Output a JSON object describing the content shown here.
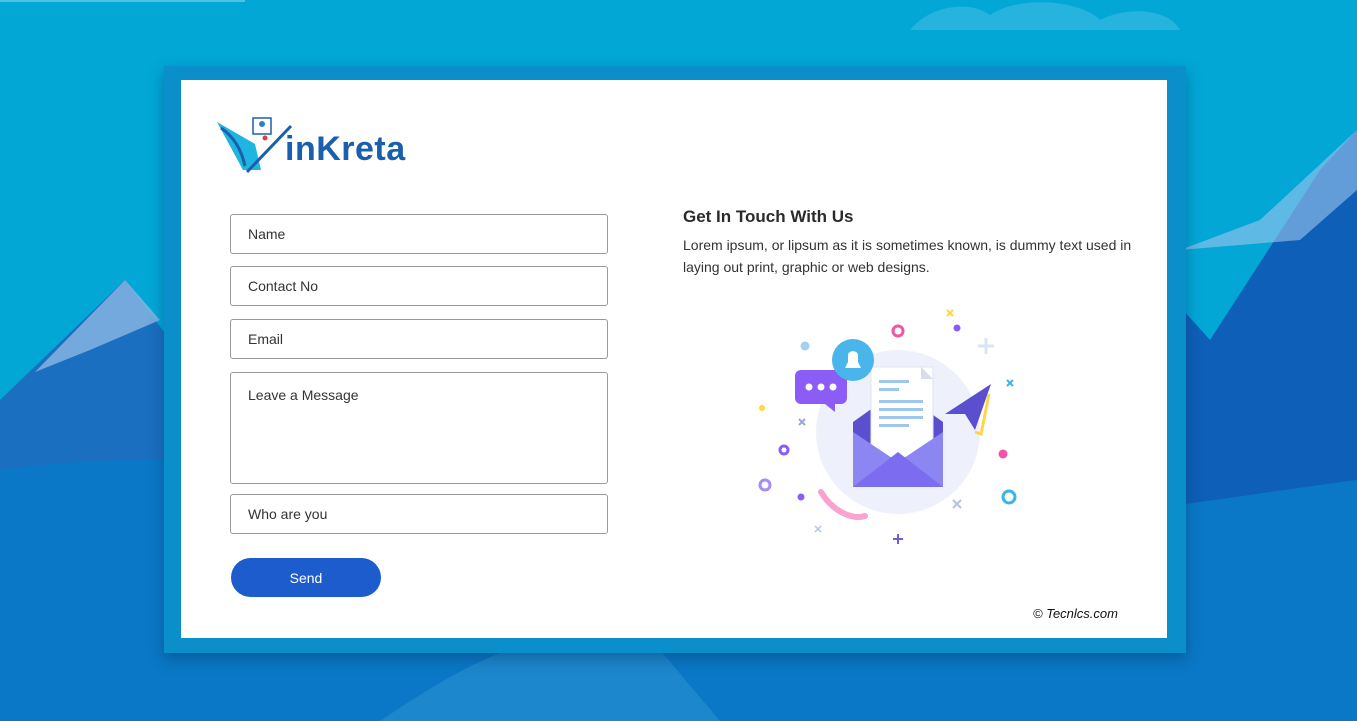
{
  "brand": {
    "logo_text": "inKreta"
  },
  "form": {
    "name_placeholder": "Name",
    "contact_placeholder": "Contact No",
    "email_placeholder": "Email",
    "message_placeholder": "Leave a Message",
    "who_placeholder": "Who are you",
    "send_label": "Send"
  },
  "info": {
    "title": "Get In Touch With Us",
    "description": "Lorem ipsum, or lipsum as it is sometimes known, is dummy text used in laying out print, graphic or web designs."
  },
  "footer": {
    "copyright": "© Tecnlcs.com"
  },
  "colors": {
    "background": "#02a7d6",
    "frame": "#0b8fca",
    "button": "#1c5ccc",
    "logo_blue": "#1a5fae",
    "illustration_purple": "#7b6cf0"
  },
  "icons": [
    "logo-icon",
    "mail-envelope-icon",
    "chat-bubble-icon",
    "bell-icon",
    "paper-plane-icon"
  ]
}
